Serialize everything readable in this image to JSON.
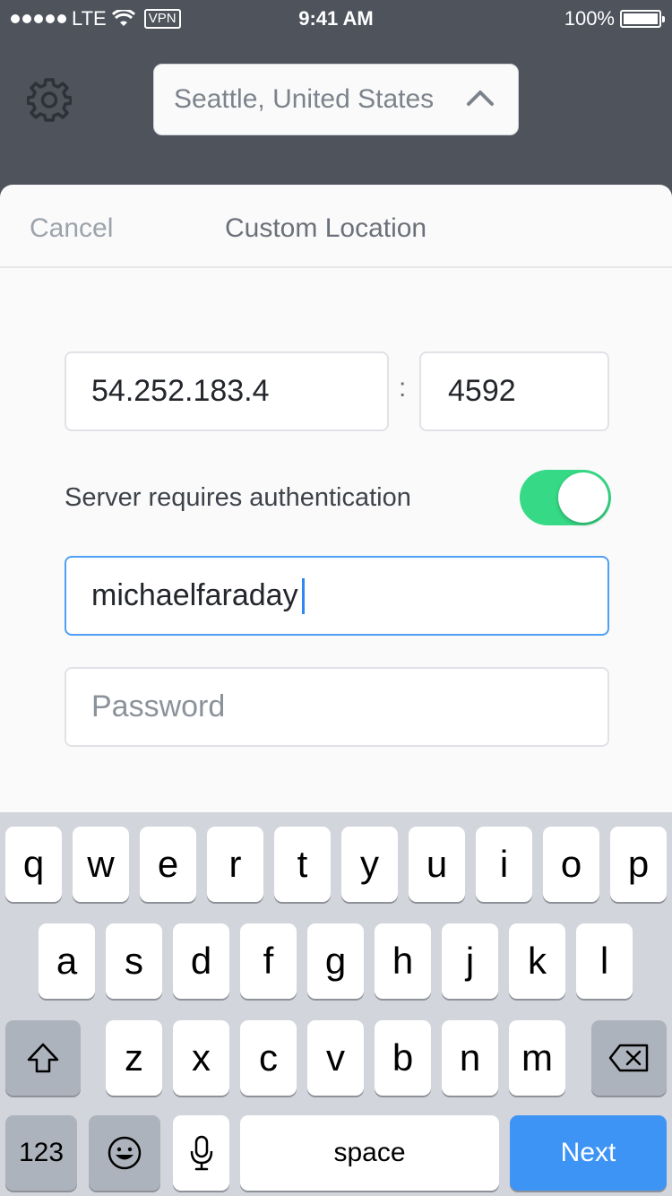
{
  "status_bar": {
    "carrier": "LTE",
    "vpn": "VPN",
    "time": "9:41 AM",
    "battery": "100%"
  },
  "header": {
    "settings_icon": "gear-icon",
    "location": "Seattle, United States",
    "location_chevron_icon": "chevron-up-icon"
  },
  "sheet": {
    "cancel_label": "Cancel",
    "title": "Custom Location",
    "host_value": "54.252.183.4",
    "separator": ":",
    "port_value": "4592",
    "auth_label": "Server requires authentication",
    "auth_enabled": true,
    "username_value": "michaelfaraday",
    "password_placeholder": "Password"
  },
  "keyboard": {
    "row1": [
      "q",
      "w",
      "e",
      "r",
      "t",
      "y",
      "u",
      "i",
      "o",
      "p"
    ],
    "row2": [
      "a",
      "s",
      "d",
      "f",
      "g",
      "h",
      "j",
      "k",
      "l"
    ],
    "row3": [
      "z",
      "x",
      "c",
      "v",
      "b",
      "n",
      "m"
    ],
    "shift_icon": "shift-icon",
    "delete_icon": "backspace-icon",
    "numbers_label": "123",
    "emoji_icon": "emoji-icon",
    "mic_icon": "microphone-icon",
    "space_label": "space",
    "next_label": "Next"
  },
  "colors": {
    "header_bg": "#4e535c",
    "toggle_on": "#36d985",
    "next_key": "#3d94f5",
    "focus_border": "#4e9ff5"
  }
}
